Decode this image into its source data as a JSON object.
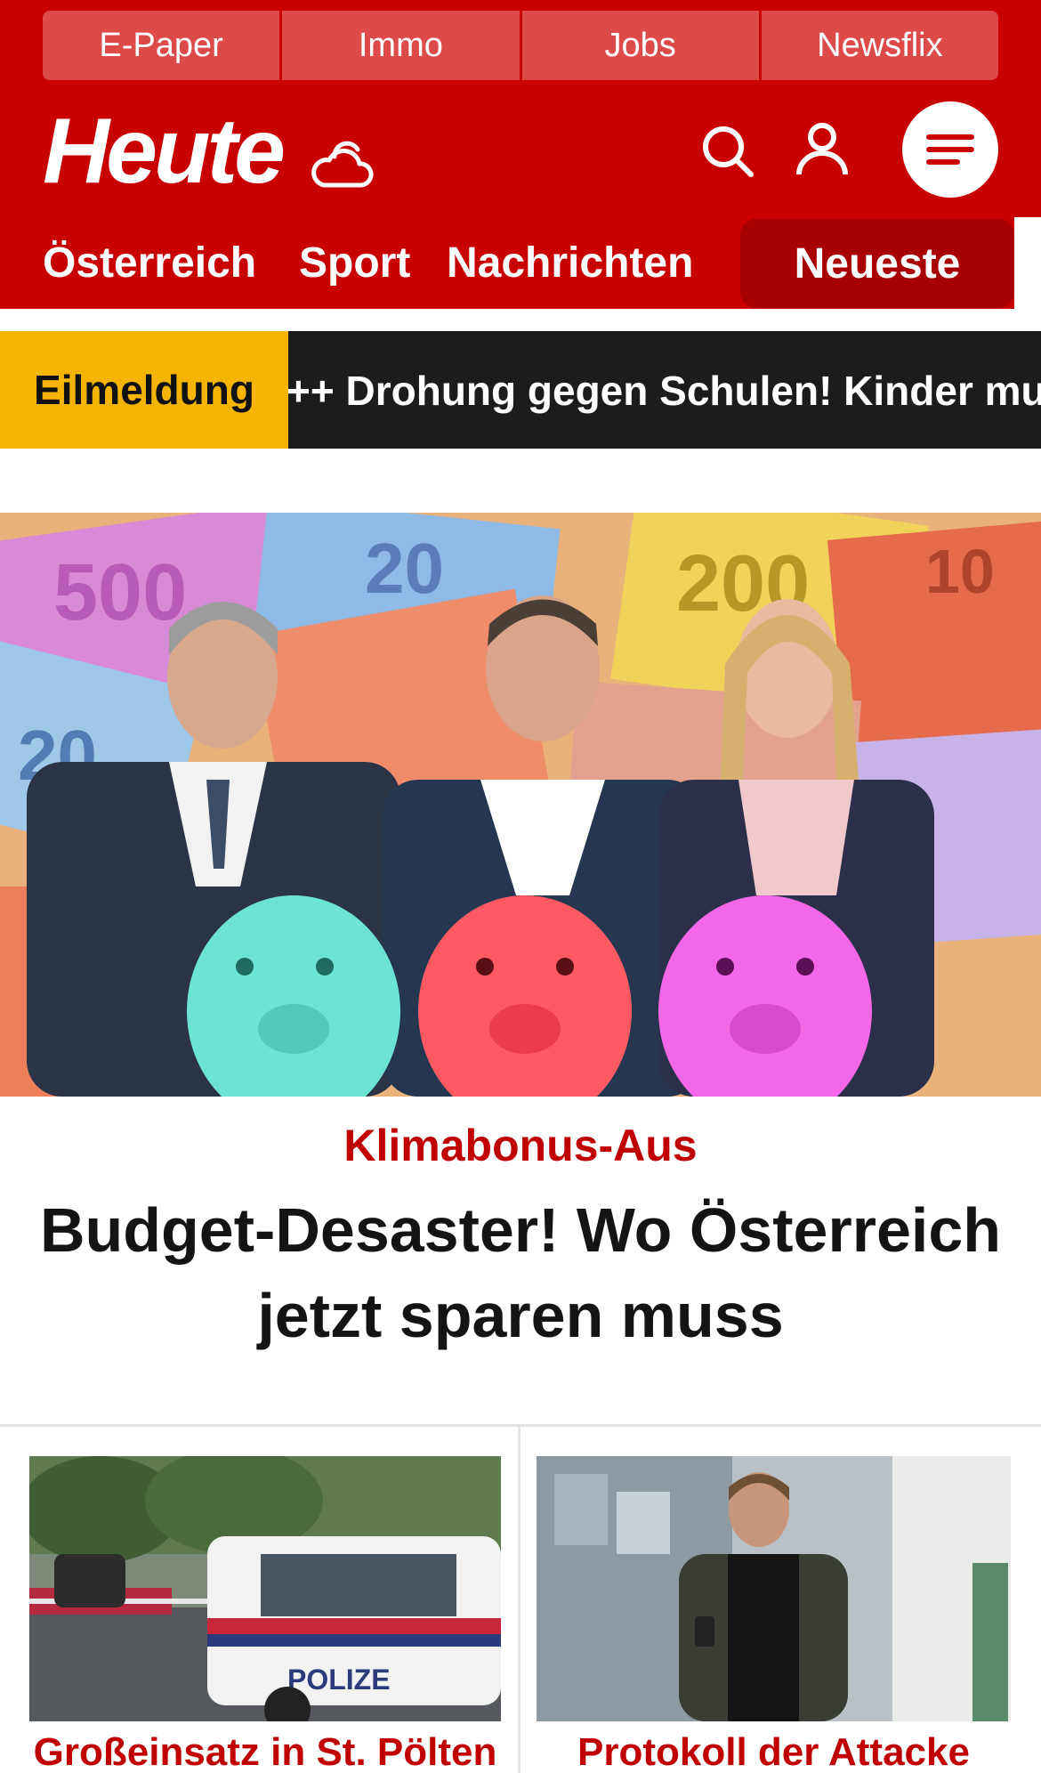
{
  "topnav": {
    "items": [
      {
        "label": "E-Paper"
      },
      {
        "label": "Immo"
      },
      {
        "label": "Jobs"
      },
      {
        "label": "Newsflix"
      }
    ]
  },
  "header": {
    "logo": "Heute",
    "icons": [
      "cloud-sun-icon",
      "search-icon",
      "user-icon",
      "menu-icon"
    ]
  },
  "mainnav": {
    "items": [
      {
        "label": "Österreich"
      },
      {
        "label": "Sport"
      },
      {
        "label": "Nachrichten"
      }
    ],
    "highlight": "Neueste"
  },
  "ticker": {
    "label": "Eilmeldung",
    "text": "++ Drohung gegen Schulen! Kinder mu"
  },
  "hero": {
    "kicker": "Klimabonus-Aus",
    "headline": "Budget-Desaster! Wo Österreich jetzt sparen muss"
  },
  "cards": [
    {
      "title": "Großeinsatz in St. Pölten",
      "image_text": "POLIZE"
    },
    {
      "title": "Protokoll der Attacke"
    }
  ],
  "colors": {
    "brand_red": "#c90000",
    "ticker_yellow": "#f4b400",
    "ticker_dark": "#1c1c1c",
    "kicker_red": "#c00000"
  }
}
